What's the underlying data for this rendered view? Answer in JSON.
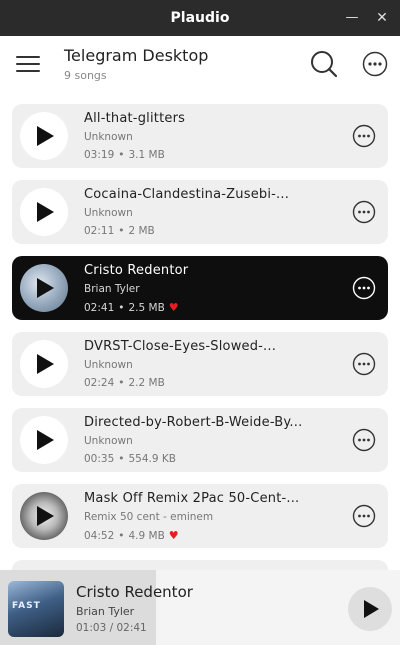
{
  "window": {
    "title": "Plaudio",
    "minimize_glyph": "—",
    "close_glyph": "✕"
  },
  "header": {
    "title": "Telegram Desktop",
    "subtitle": "9 songs",
    "menu_icon": "hamburger-icon",
    "search_icon": "search-icon",
    "more_icon": "more-icon"
  },
  "songs": [
    {
      "title": "All-that-glitters",
      "artist": "Unknown",
      "duration": "03:19",
      "size": "3.1 MB",
      "favorite": false,
      "active": false
    },
    {
      "title": "Cocaina-Clandestina-Zusebi-...",
      "artist": "Unknown",
      "duration": "02:11",
      "size": "2 MB",
      "favorite": false,
      "active": false
    },
    {
      "title": "Cristo Redentor",
      "artist": "Brian Tyler",
      "duration": "02:41",
      "size": "2.5 MB",
      "favorite": true,
      "active": true
    },
    {
      "title": "DVRST-Close-Eyes-Slowed-...",
      "artist": "Unknown",
      "duration": "02:24",
      "size": "2.2 MB",
      "favorite": false,
      "active": false
    },
    {
      "title": "Directed-by-Robert-B-Weide-By...",
      "artist": "Unknown",
      "duration": "00:35",
      "size": "554.9 KB",
      "favorite": false,
      "active": false
    },
    {
      "title": "Mask Off Remix 2Pac 50-Cent-...",
      "artist": "Remix 50 cent - eminem",
      "duration": "04:52",
      "size": "4.9 MB",
      "favorite": true,
      "active": false
    }
  ],
  "meta_separator": "•",
  "heart_glyph": "♥",
  "player": {
    "title": "Cristo Redentor",
    "artist": "Brian Tyler",
    "time": "01:03 / 02:41",
    "progress": 0.39,
    "cover_text": "FAST"
  },
  "colors": {
    "accent_heart": "#e32020",
    "active_row": "#0e0e0e",
    "row_bg": "#efefef"
  }
}
